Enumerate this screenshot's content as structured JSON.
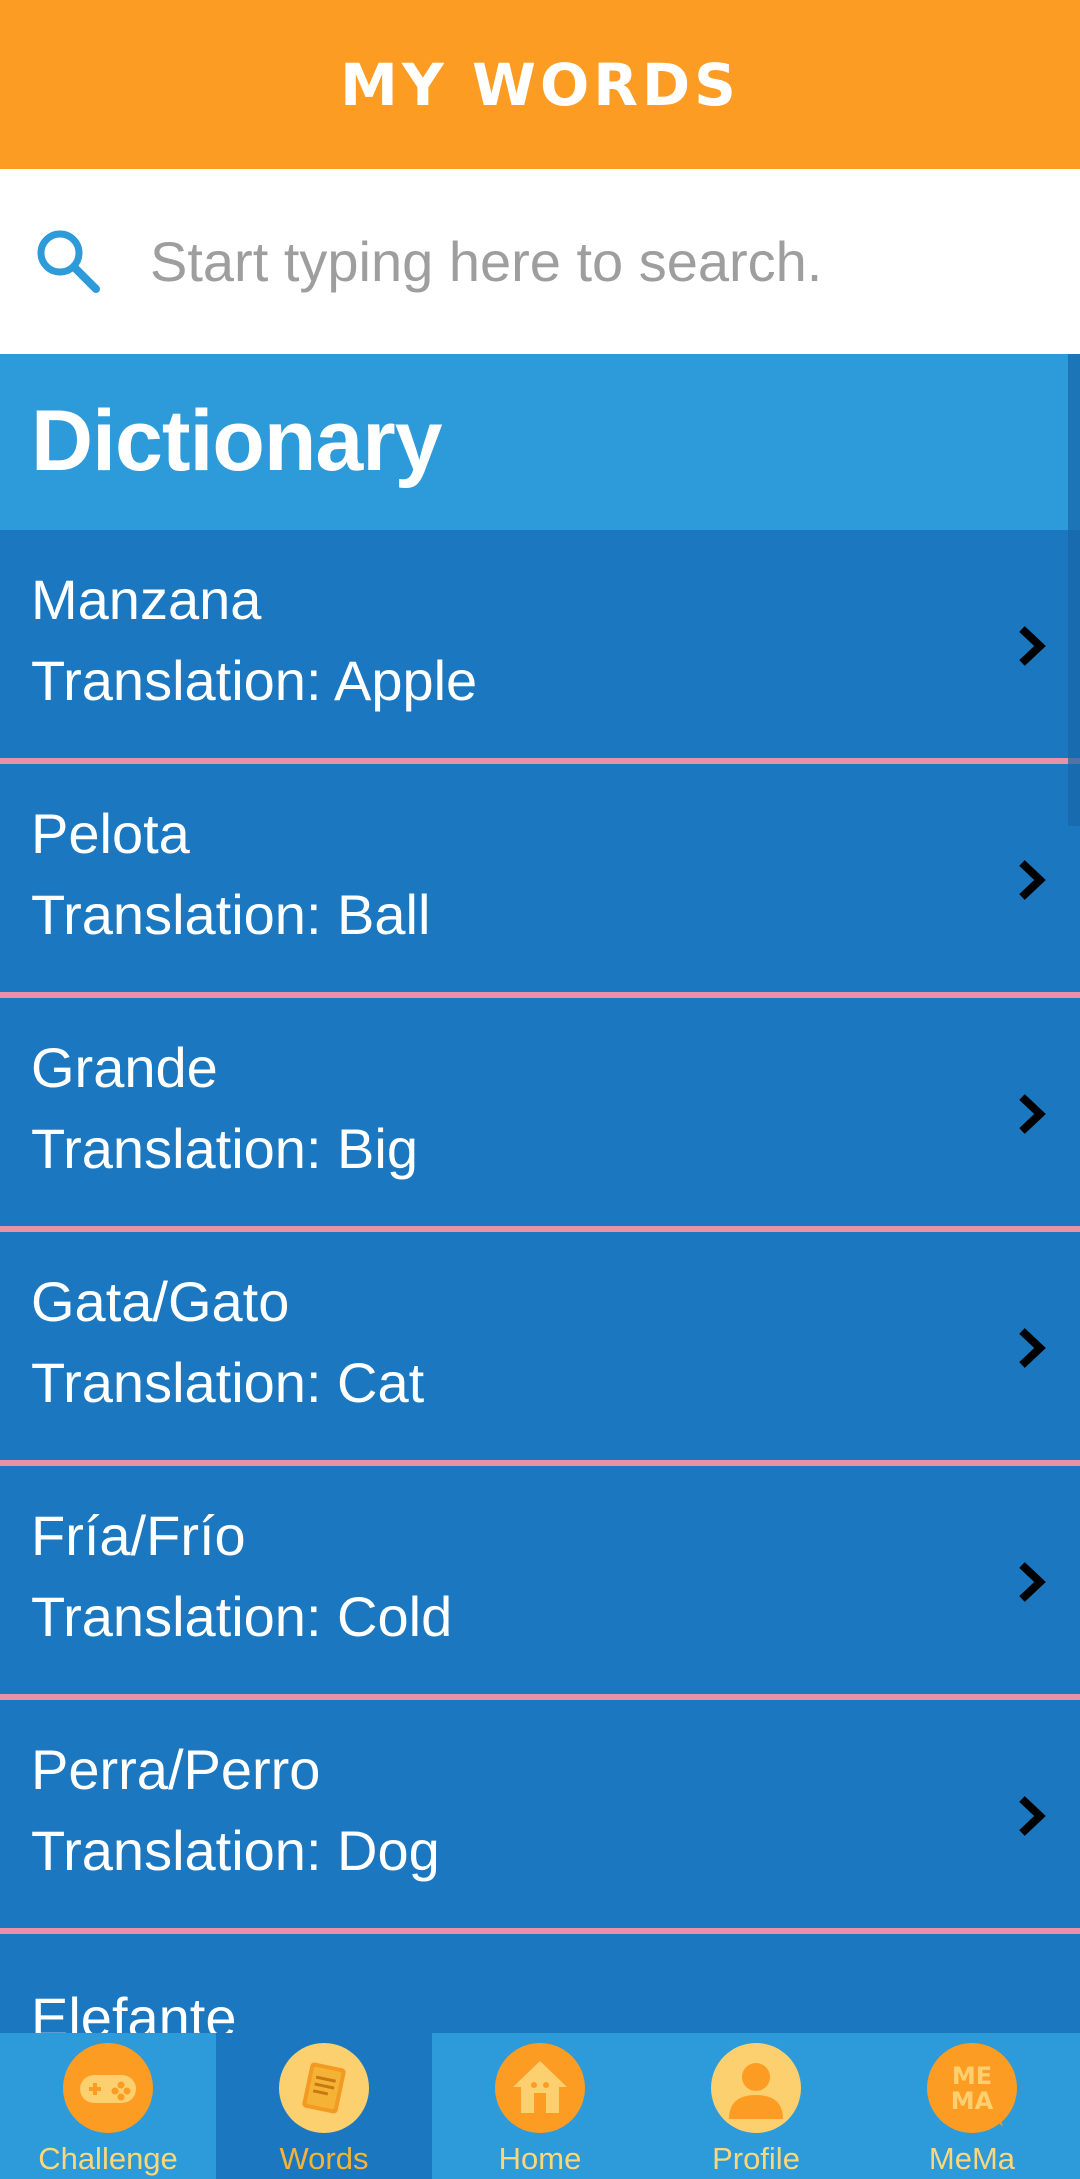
{
  "header": {
    "title": "My Words"
  },
  "search": {
    "placeholder": "Start typing here to search.",
    "value": ""
  },
  "section": {
    "title": "Dictionary"
  },
  "words": [
    {
      "word": "Manzana",
      "translation": "Translation: Apple"
    },
    {
      "word": "Pelota",
      "translation": "Translation: Ball"
    },
    {
      "word": "Grande",
      "translation": "Translation: Big"
    },
    {
      "word": "Gata/Gato",
      "translation": "Translation: Cat"
    },
    {
      "word": "Fría/Frío",
      "translation": "Translation: Cold"
    },
    {
      "word": "Perra/Perro",
      "translation": "Translation: Dog"
    },
    {
      "word": "Elefante",
      "translation": ""
    }
  ],
  "nav": {
    "active": "Words",
    "tabs": [
      {
        "label": "Challenge",
        "icon": "gamepad-icon"
      },
      {
        "label": "Words",
        "icon": "book-icon"
      },
      {
        "label": "Home",
        "icon": "house-icon"
      },
      {
        "label": "Profile",
        "icon": "person-icon"
      },
      {
        "label": "MeMa",
        "icon": "mema-logo-icon",
        "logo_text": "ME MA"
      }
    ]
  },
  "colors": {
    "header": "#fd9c23",
    "section": "#2d9ad9",
    "list_item": "#1b78c0",
    "divider": "#e991a6",
    "nav_label": "#fcd77a"
  }
}
